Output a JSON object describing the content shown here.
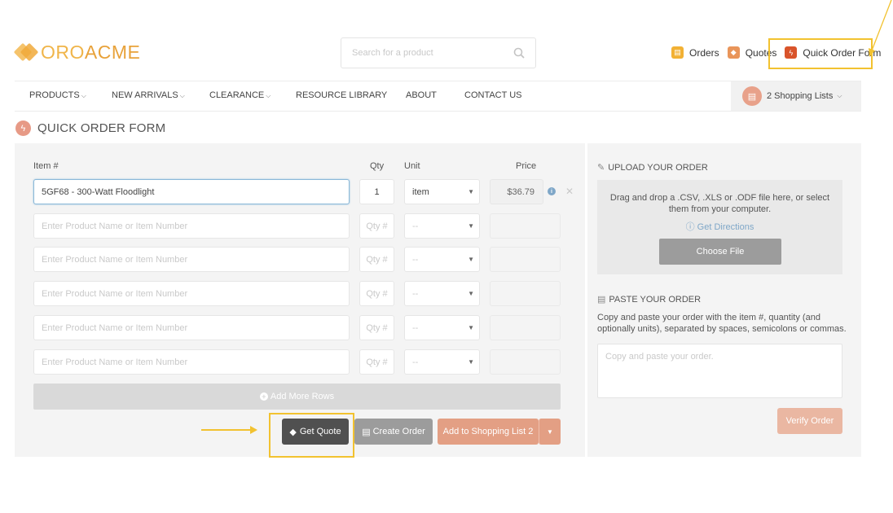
{
  "header": {
    "logo_part1": "ORO",
    "logo_part2": "ACME",
    "search_placeholder": "Search for a product",
    "top_links": {
      "orders": "Orders",
      "quotes": "Quotes",
      "quick_order_form": "Quick Order Form"
    }
  },
  "nav": {
    "items": [
      "PRODUCTS",
      "NEW ARRIVALS",
      "CLEARANCE",
      "RESOURCE LIBRARY",
      "ABOUT",
      "CONTACT US"
    ],
    "shopping_lists": "2 Shopping Lists"
  },
  "page": {
    "title": "QUICK ORDER FORM"
  },
  "order_form": {
    "columns": {
      "item": "Item #",
      "qty": "Qty",
      "unit": "Unit",
      "price": "Price"
    },
    "first_row": {
      "item": "5GF68 - 300-Watt Floodlight",
      "qty": "1",
      "unit": "item",
      "price": "$36.79"
    },
    "empty_row": {
      "item_placeholder": "Enter Product Name or Item Number",
      "qty_placeholder": "Qty #",
      "unit": "--"
    },
    "add_more_rows": "Add More Rows",
    "buttons": {
      "get_quote": "Get Quote",
      "create_order": "Create Order",
      "add_to_shopping_list": "Add to Shopping List 2"
    }
  },
  "upload": {
    "heading": "UPLOAD YOUR ORDER",
    "text": "Drag and drop a .CSV, .XLS or .ODF file here, or select them from your computer.",
    "directions": "Get Directions",
    "choose_file": "Choose File"
  },
  "paste": {
    "heading": "PASTE YOUR ORDER",
    "description": "Copy and paste your order with the item #, quantity (and optionally units), separated by spaces, semicolons or commas.",
    "placeholder": "Copy and paste your order.",
    "verify": "Verify Order"
  },
  "colors": {
    "highlight": "#f2c230",
    "accent": "#e39f84",
    "dark_button": "#505050"
  }
}
